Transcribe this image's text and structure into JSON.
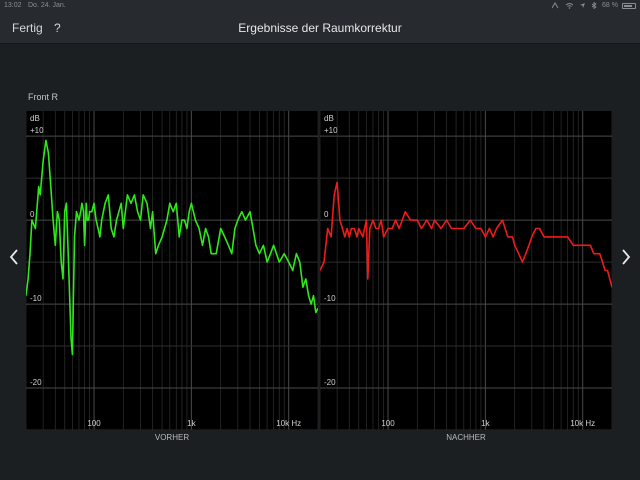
{
  "status_bar": {
    "time": "13:02",
    "date": "Do. 24. Jan.",
    "battery": "68 %",
    "icons": [
      "signal-icon",
      "wifi-icon",
      "location-icon",
      "bluetooth-icon"
    ]
  },
  "navbar": {
    "done_label": "Fertig",
    "help_label": "?",
    "title": "Ergebnisse der Raumkorrektur"
  },
  "channel_label": "Front R",
  "chart_data": [
    {
      "type": "line",
      "xlabel": "VORHER",
      "ylabel": "dB",
      "x_scale": "log",
      "xlim": [
        20,
        20000
      ],
      "ylim": [
        -25,
        13
      ],
      "y_ticks": [
        {
          "v": 10,
          "label": "+10"
        },
        {
          "v": 0,
          "label": "0"
        },
        {
          "v": -10,
          "label": "-10"
        },
        {
          "v": -20,
          "label": "-20"
        }
      ],
      "x_ticks": [
        {
          "v": 100,
          "label": "100"
        },
        {
          "v": 1000,
          "label": "1k"
        },
        {
          "v": 10000,
          "label": "10k Hz"
        }
      ],
      "grid": true,
      "series": [
        {
          "color": "#2ee81a",
          "x": [
            20,
            21,
            22,
            23,
            25,
            27,
            28,
            30,
            32,
            34,
            36,
            38,
            40,
            42,
            44,
            46,
            48,
            50,
            52,
            55,
            58,
            60,
            63,
            66,
            70,
            73,
            75,
            78,
            80,
            83,
            85,
            88,
            90,
            95,
            100,
            105,
            110,
            115,
            120,
            130,
            140,
            150,
            160,
            170,
            180,
            190,
            200,
            220,
            240,
            260,
            280,
            300,
            320,
            350,
            380,
            400,
            430,
            460,
            500,
            530,
            560,
            600,
            650,
            700,
            750,
            800,
            850,
            900,
            950,
            1000,
            1100,
            1200,
            1300,
            1400,
            1500,
            1600,
            1800,
            2000,
            2200,
            2400,
            2600,
            2800,
            3000,
            3300,
            3600,
            4000,
            4300,
            4600,
            5000,
            5500,
            6000,
            6500,
            7000,
            8000,
            9000,
            10000,
            11000,
            12000,
            13000,
            14000,
            15000,
            16000,
            17000,
            18000,
            19000,
            20000
          ],
          "y": [
            -9,
            -7,
            -4,
            0,
            -1,
            4,
            3,
            7,
            9.5,
            8,
            4,
            0,
            -3,
            1,
            0,
            -5,
            -7,
            1,
            2,
            -6,
            -14,
            -16,
            -2,
            1,
            0,
            1,
            2,
            1,
            -3,
            2,
            0,
            0,
            1,
            1,
            2,
            0,
            -1,
            -2,
            0,
            2,
            3,
            -1,
            -2,
            0,
            1,
            2,
            -1,
            3,
            2,
            3,
            1,
            0,
            3,
            2,
            -1,
            1,
            -4,
            -3,
            -2,
            -1,
            0,
            2,
            1,
            2,
            -2,
            0,
            0,
            -1,
            1,
            2,
            0,
            -1,
            -3,
            -1,
            -2,
            -4,
            -4,
            -1,
            -2,
            -3,
            -4,
            -1,
            0,
            1,
            0,
            1,
            -1,
            -3,
            -4,
            -3,
            -5,
            -4,
            -3,
            -5,
            -4,
            -5,
            -6,
            -4,
            -5,
            -8,
            -7,
            -9,
            -10,
            -9,
            -11,
            -10.5
          ]
        }
      ]
    },
    {
      "type": "line",
      "xlabel": "NACHHER",
      "ylabel": "dB",
      "x_scale": "log",
      "xlim": [
        20,
        20000
      ],
      "ylim": [
        -25,
        13
      ],
      "y_ticks": [
        {
          "v": 10,
          "label": "+10"
        },
        {
          "v": 0,
          "label": "0"
        },
        {
          "v": -10,
          "label": "-10"
        },
        {
          "v": -20,
          "label": "-20"
        }
      ],
      "x_ticks": [
        {
          "v": 100,
          "label": "100"
        },
        {
          "v": 1000,
          "label": "1k"
        },
        {
          "v": 10000,
          "label": "10k Hz"
        }
      ],
      "grid": true,
      "series": [
        {
          "color": "#ee1b1b",
          "x": [
            20,
            22,
            24,
            26,
            28,
            30,
            32,
            34,
            36,
            38,
            40,
            42,
            45,
            48,
            50,
            55,
            60,
            62,
            65,
            70,
            75,
            80,
            85,
            90,
            100,
            110,
            120,
            130,
            140,
            150,
            170,
            200,
            220,
            250,
            280,
            300,
            350,
            400,
            450,
            500,
            550,
            600,
            700,
            800,
            900,
            1000,
            1100,
            1200,
            1300,
            1500,
            1700,
            1900,
            2000,
            2200,
            2400,
            2600,
            2800,
            3000,
            3300,
            3600,
            4000,
            4500,
            5000,
            5500,
            6000,
            7000,
            8000,
            9000,
            10000,
            11000,
            12000,
            13000,
            14000,
            15000,
            16000,
            17000,
            18000,
            19000,
            20000
          ],
          "y": [
            -6,
            -5,
            -1,
            -2,
            3,
            4.5,
            0,
            -1,
            -2,
            -1,
            -2,
            -1,
            -1,
            -2,
            -1,
            -2,
            0,
            -7,
            -1,
            0,
            -1,
            -1,
            0,
            -2,
            -1,
            -1,
            0,
            -1,
            0,
            1,
            0,
            0,
            -1,
            0,
            -1,
            0,
            -1,
            0,
            -1,
            -1,
            -1,
            -1,
            0,
            -1,
            -1,
            -2,
            -1,
            -2,
            -1,
            0,
            -2,
            -2,
            -3,
            -4,
            -5,
            -4,
            -3,
            -2,
            -1,
            -1,
            -2,
            -2,
            -2,
            -2,
            -2,
            -2,
            -3,
            -3,
            -3,
            -3,
            -3,
            -4,
            -4,
            -4,
            -5,
            -6,
            -6,
            -7,
            -8
          ]
        }
      ]
    }
  ]
}
